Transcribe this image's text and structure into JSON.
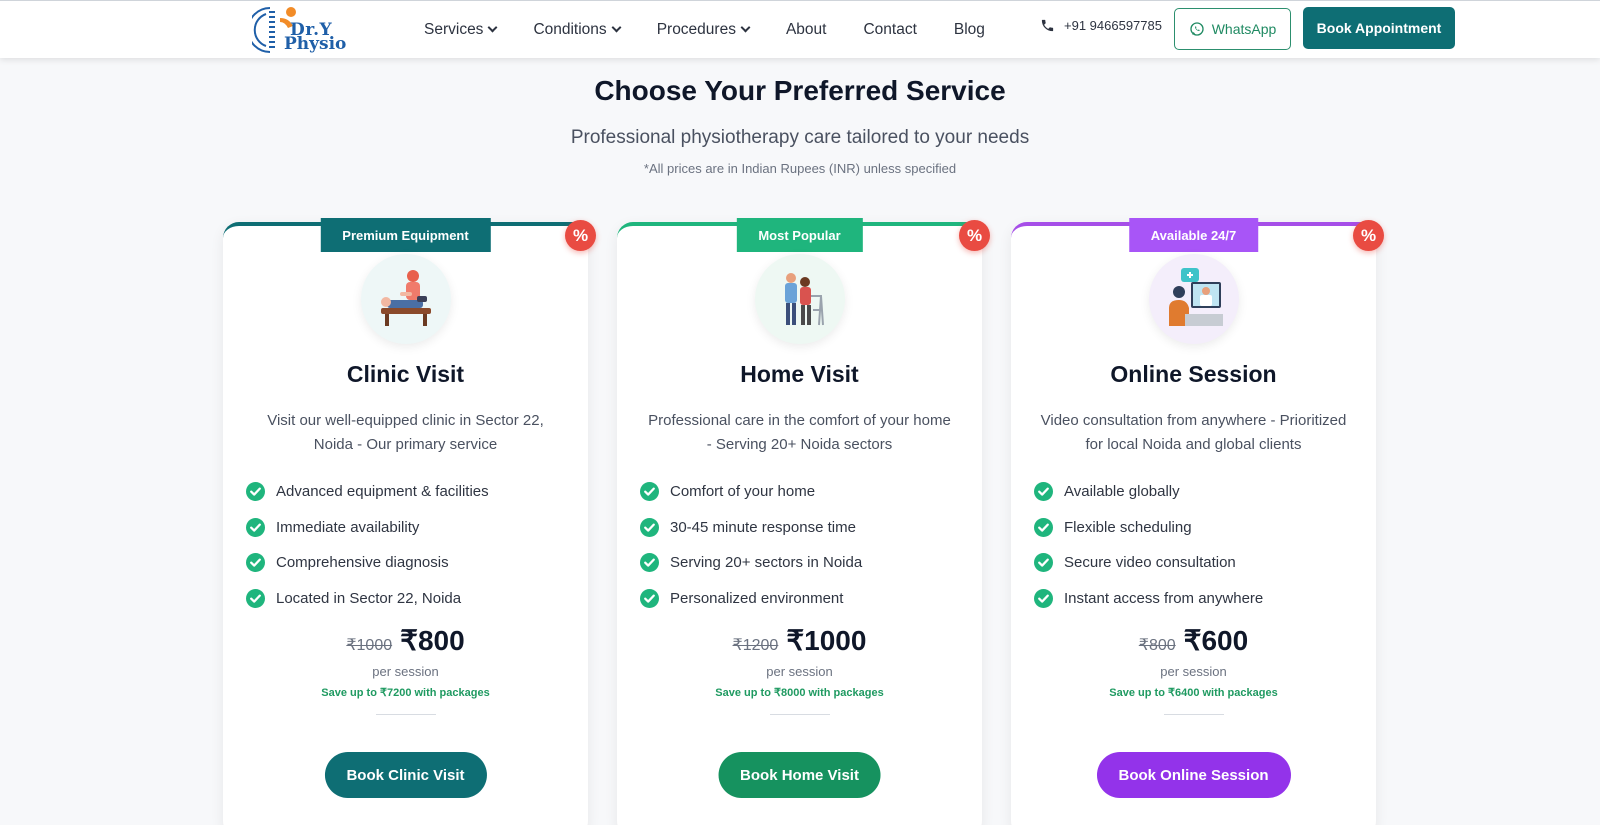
{
  "header": {
    "logo": {
      "line1": "Dr.Y",
      "line2": "Physio"
    },
    "nav": [
      {
        "label": "Services",
        "dropdown": true
      },
      {
        "label": "Conditions",
        "dropdown": true
      },
      {
        "label": "Procedures",
        "dropdown": true
      },
      {
        "label": "About",
        "dropdown": false
      },
      {
        "label": "Contact",
        "dropdown": false
      },
      {
        "label": "Blog",
        "dropdown": false
      }
    ],
    "phone": "+91 9466597785",
    "whatsapp_label": "WhatsApp",
    "book_label": "Book Appointment"
  },
  "section": {
    "title": "Choose Your Preferred Service",
    "subtitle": "Professional physiotherapy care tailored to your needs",
    "note": "*All prices are in Indian Rupees (INR) unless specified"
  },
  "cards": [
    {
      "badge": "Premium Equipment",
      "discount_symbol": "%",
      "icon": "clinic-therapy-icon",
      "title": "Clinic Visit",
      "description": "Visit our well-equipped clinic in Sector 22, Noida - Our primary service",
      "features": [
        "Advanced equipment & facilities",
        "Immediate availability",
        "Comprehensive diagnosis",
        "Located in Sector 22, Noida"
      ],
      "old_price": "₹1000",
      "price": "₹800",
      "per": "per session",
      "save": "Save up to ₹7200 with packages",
      "cta": "Book Clinic Visit",
      "colors": {
        "accent": "#0e6e74",
        "badge": "#0e6e74",
        "cta": "#0e6e74",
        "circle": "#eef7f7"
      }
    },
    {
      "badge": "Most Popular",
      "discount_symbol": "%",
      "icon": "home-care-icon",
      "title": "Home Visit",
      "description": "Professional care in the comfort of your home - Serving 20+ Noida sectors",
      "features": [
        "Comfort of your home",
        "30-45 minute response time",
        "Serving 20+ sectors in Noida",
        "Personalized environment"
      ],
      "old_price": "₹1200",
      "price": "₹1000",
      "per": "per session",
      "save": "Save up to ₹8000 with packages",
      "cta": "Book Home Visit",
      "colors": {
        "accent": "#1fb57d",
        "badge": "#1fb57d",
        "cta": "#16925f",
        "circle": "#eef8f3"
      }
    },
    {
      "badge": "Available 24/7",
      "discount_symbol": "%",
      "icon": "online-consultation-icon",
      "title": "Online Session",
      "description": "Video consultation from anywhere - Prioritized for local Noida and global clients",
      "features": [
        "Available globally",
        "Flexible scheduling",
        "Secure video consultation",
        "Instant access from anywhere"
      ],
      "old_price": "₹800",
      "price": "₹600",
      "per": "per session",
      "save": "Save up to ₹6400 with packages",
      "cta": "Book Online Session",
      "colors": {
        "accent": "#a64ee8",
        "badge": "#a855f7",
        "cta": "#9333ea",
        "circle": "#f4eefb"
      }
    }
  ]
}
